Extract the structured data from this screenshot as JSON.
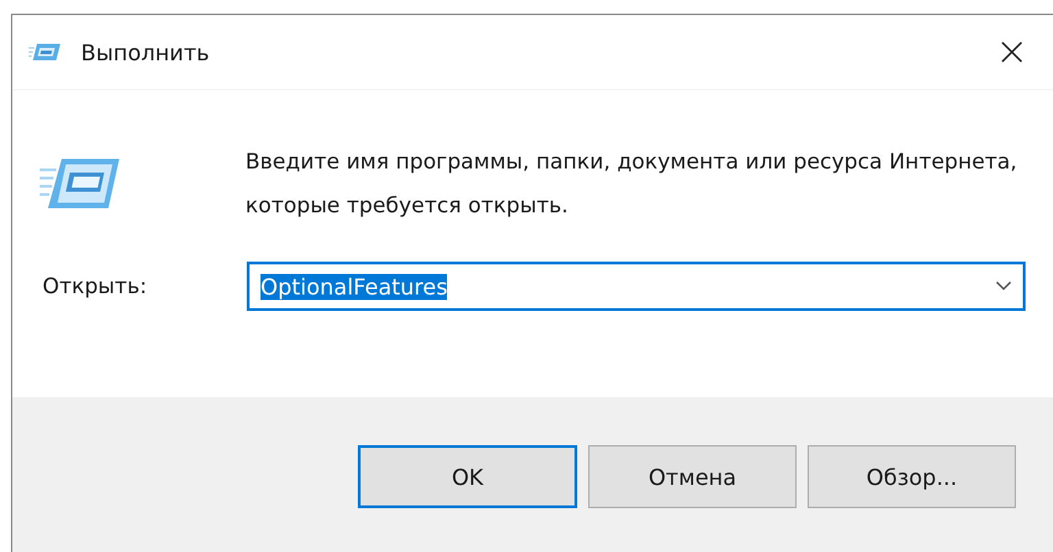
{
  "window": {
    "title": "Выполнить"
  },
  "message": "Введите имя программы, папки, документа или ресурса Интернета, которые требуется открыть.",
  "open_field": {
    "label": "Открыть:",
    "value": "OptionalFeatures",
    "selected": true
  },
  "buttons": [
    {
      "label": "OK",
      "focused": true
    },
    {
      "label": "Отмена",
      "focused": false
    },
    {
      "label": "Обзор...",
      "focused": false
    }
  ]
}
